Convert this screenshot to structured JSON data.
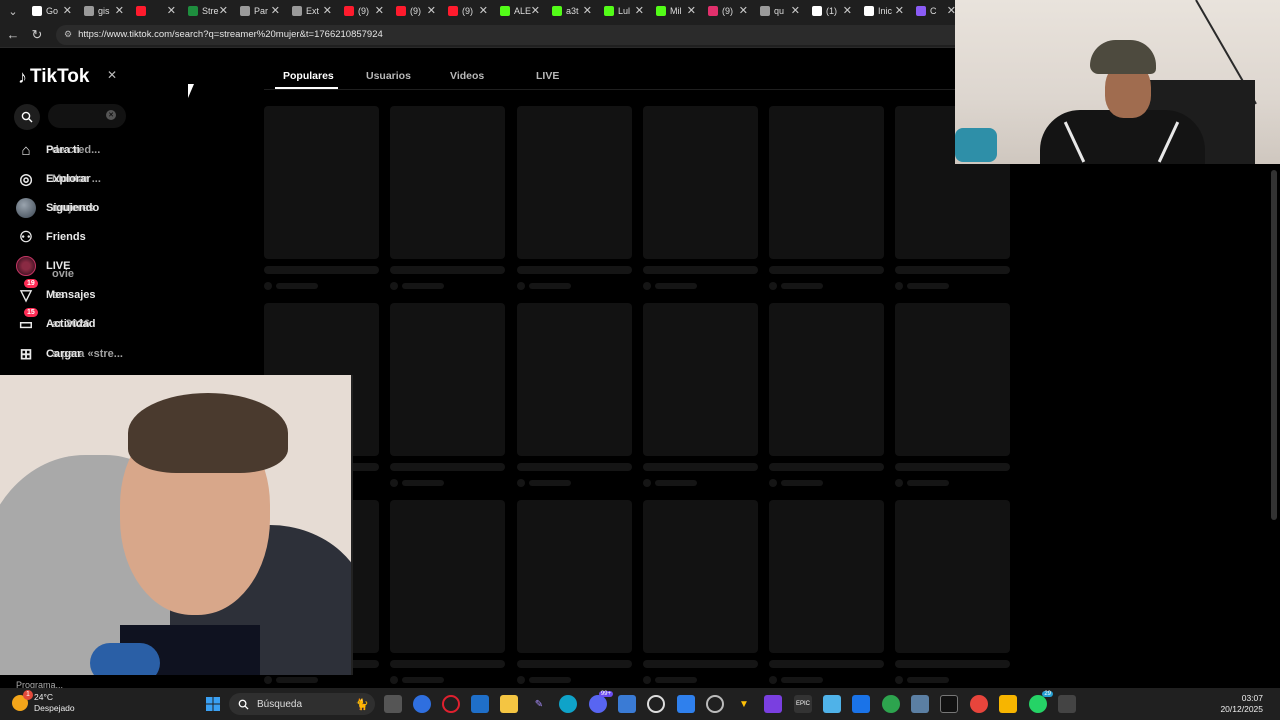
{
  "browser": {
    "tabs": [
      {
        "title": "Go",
        "icon": "google-icon",
        "color": "#ffffff"
      },
      {
        "title": "gis",
        "icon": "globe-icon",
        "color": "#9a9a9a"
      },
      {
        "title": "",
        "icon": "opera-icon",
        "color": "#ff1b2d"
      },
      {
        "title": "Stre",
        "icon": "chart-icon",
        "color": "#1e8e3e"
      },
      {
        "title": "Par",
        "icon": "globe-icon",
        "color": "#9a9a9a"
      },
      {
        "title": "Ext",
        "icon": "loading-icon",
        "color": "#9a9a9a"
      },
      {
        "title": "(9)",
        "icon": "opera-icon",
        "color": "#ff1b2d"
      },
      {
        "title": "(9)",
        "icon": "opera-icon",
        "color": "#ff1b2d"
      },
      {
        "title": "(9)",
        "icon": "opera-icon",
        "color": "#ff1b2d"
      },
      {
        "title": "ALE",
        "icon": "kick-icon",
        "color": "#53fc18"
      },
      {
        "title": "a3t",
        "icon": "kick-icon",
        "color": "#53fc18"
      },
      {
        "title": "Lul",
        "icon": "kick-icon",
        "color": "#53fc18"
      },
      {
        "title": "Mil",
        "icon": "kick-icon",
        "color": "#53fc18"
      },
      {
        "title": "(9)",
        "icon": "instagram-icon",
        "color": "#e1306c"
      },
      {
        "title": "qu",
        "icon": "globe-icon",
        "color": "#9a9a9a"
      },
      {
        "title": "(1)",
        "icon": "x-icon",
        "color": "#ffffff"
      },
      {
        "title": "Inic",
        "icon": "x-icon",
        "color": "#ffffff"
      },
      {
        "title": "C",
        "icon": "feather-icon",
        "color": "#8b5cf6"
      }
    ],
    "url": "https://www.tiktok.com/search?q=streamer%20mujer&t=1766210857924"
  },
  "tiktok": {
    "logo": "TikTok",
    "search_value": "",
    "nav": [
      {
        "label": "Para ti",
        "ghost": "de cred...",
        "icon": "home-icon"
      },
      {
        "label": "Explorar",
        "ghost": "Montar ...",
        "icon": "compass-icon"
      },
      {
        "label": "Siguiendo",
        "ghost": "mujeres",
        "icon": "following-avatar"
      },
      {
        "label": "Friends",
        "ghost": "",
        "icon": "friends-icon"
      },
      {
        "label": "LIVE",
        "ghost": "ovie",
        "icon": "live-icon"
      },
      {
        "label": "Mensajes",
        "ghost": "os",
        "icon": "messages-icon",
        "badge": "19"
      },
      {
        "label": "Actividad",
        "ghost": "ar 2026",
        "icon": "activity-icon",
        "badge": "15"
      },
      {
        "label": "Cargar",
        "ghost": "s para «stre...",
        "icon": "upload-icon"
      }
    ],
    "ghost_extra": "Programa...",
    "tabs": [
      "Populares",
      "Usuarios",
      "Videos",
      "LIVE"
    ],
    "active_tab": "Populares"
  },
  "taskbar": {
    "weather_temp": "24°C",
    "weather_desc": "Despejado",
    "weather_alert": "1",
    "search_label": "Búsqueda",
    "time": "03:07",
    "date": "20/12/2025",
    "badges": {
      "discord": "99+",
      "whatsapp": "29"
    }
  }
}
